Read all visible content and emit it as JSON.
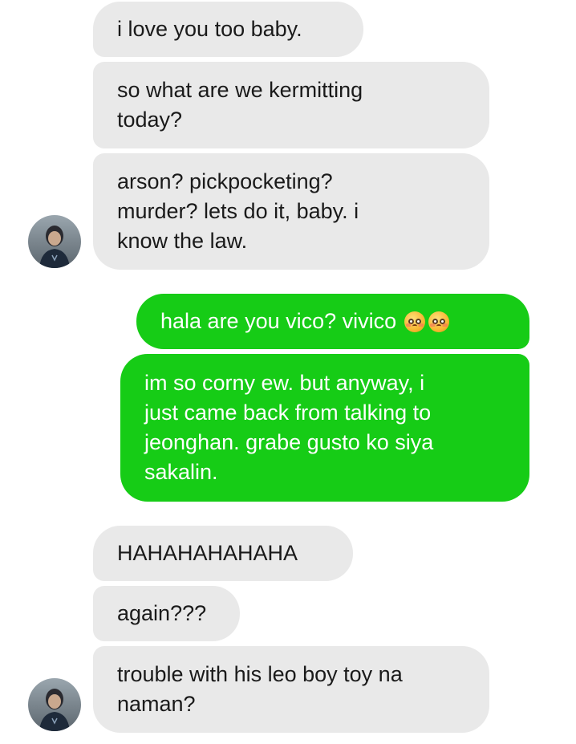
{
  "messages": [
    {
      "id": "m1",
      "direction": "incoming",
      "text": "i love you too baby."
    },
    {
      "id": "m2",
      "direction": "incoming",
      "text": "so what are we kermitting\ntoday?"
    },
    {
      "id": "m3",
      "direction": "incoming",
      "text": "arson? pickpocketing?\nmurder? lets do it, baby. i\nknow the law."
    },
    {
      "id": "m4",
      "direction": "outgoing",
      "text": "hala are you vico? vivico",
      "emojis": [
        "pleading-face-icon",
        "pleading-face-icon"
      ]
    },
    {
      "id": "m5",
      "direction": "outgoing",
      "text": "im so corny ew. but anyway, i\njust came back from talking to\njeonghan. grabe gusto ko siya\nsakalin."
    },
    {
      "id": "m6",
      "direction": "incoming",
      "text": "HAHAHAHAHAHA"
    },
    {
      "id": "m7",
      "direction": "incoming",
      "text": "again???"
    },
    {
      "id": "m8",
      "direction": "incoming",
      "text": "trouble with his leo boy toy na\nnaman?"
    }
  ],
  "colors": {
    "incoming_bubble": "#e9e9e9",
    "outgoing_bubble": "#16cc16",
    "incoming_text": "#1a1a1a",
    "outgoing_text": "#ffffff",
    "background": "#ffffff"
  },
  "avatars": [
    "contact-avatar",
    "contact-avatar"
  ]
}
